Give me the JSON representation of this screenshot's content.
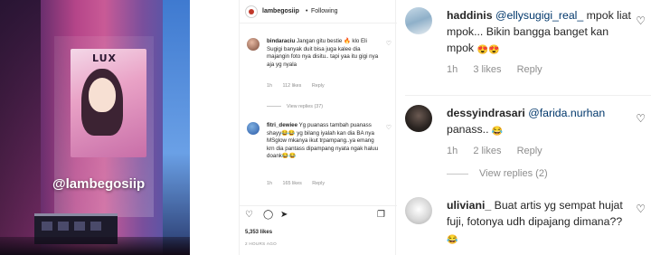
{
  "photo": {
    "watermark": "@lambegosiip",
    "billboard_brand": "LUX"
  },
  "post": {
    "header": {
      "username": "lambegosiip",
      "separator": "•",
      "follow_status": "Following"
    },
    "comments": [
      {
        "username": "bindaraciu",
        "text": "Jangan gitu bestie 🔥 klo Eli Sugigi banyak duit bisa juga kalee dia majangin foto nya disitu.. tapi yaa itu gigi nya aja yg nyala",
        "time": "1h",
        "likes": "112 likes",
        "reply": "Reply",
        "view_replies": "View replies (37)"
      },
      {
        "username": "fitri_dewiee",
        "text": "Yg puanass tambah puanass shayy😂😂 yg bilang iyalah kan dia BA nya MSglow mkanya ikut trpampang..ya emang krn dia pantass dipampang nyata ngak haluu doank😂😂",
        "time": "1h",
        "likes": "165 likes",
        "reply": "Reply"
      }
    ],
    "likes_count": "5,353 likes",
    "timestamp": "2 HOURS AGO"
  },
  "comments_panel": [
    {
      "username": "haddinis",
      "mention": "@ellysugigi_real_",
      "text": " mpok liat mpok... Bikin bangga banget kan mpok",
      "emoji": "😍😍",
      "time": "1h",
      "likes": "3 likes",
      "reply": "Reply"
    },
    {
      "username": "dessyindrasari",
      "mention": "@farida.nurhan",
      "text": " panass..",
      "emoji": "😂",
      "time": "1h",
      "likes": "2 likes",
      "reply": "Reply",
      "view_replies": "View replies (2)"
    },
    {
      "username": "uliviani_",
      "text": " Buat artis yg sempat hujat fuji, fotonya udh dipajang dimana??",
      "emoji": "😂"
    }
  ],
  "icons": [
    "heart-icon",
    "comment-icon",
    "share-icon",
    "save-icon"
  ],
  "colors": {
    "text": "#262626",
    "muted": "#8e8e8e",
    "mention": "#00376b",
    "border": "#efefef"
  }
}
